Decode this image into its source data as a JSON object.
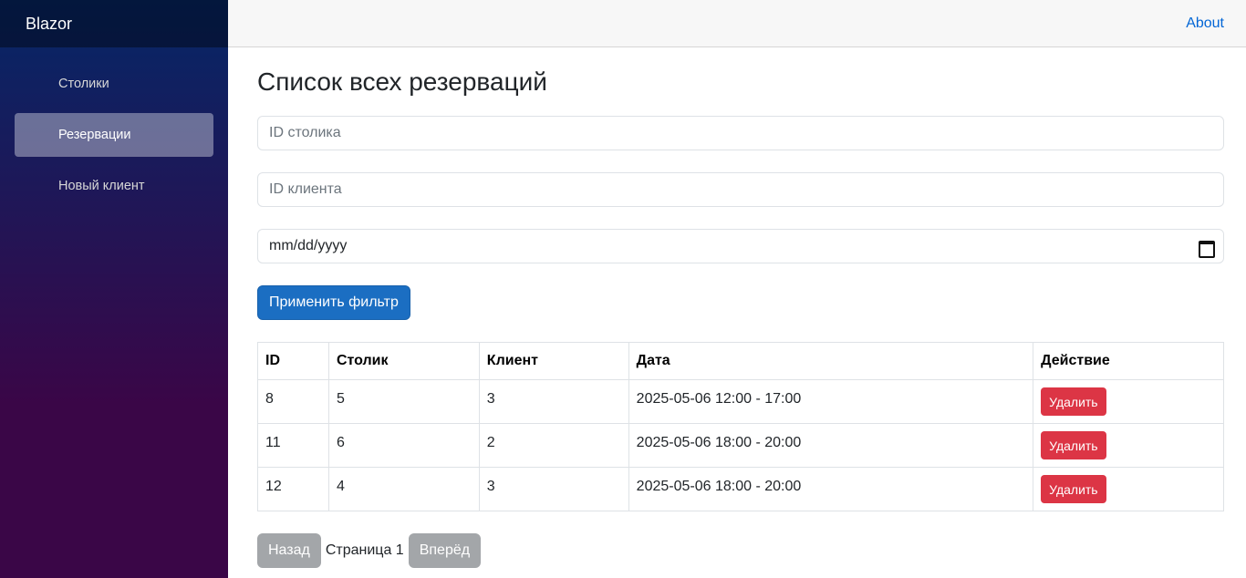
{
  "app": {
    "brand": "Blazor"
  },
  "sidebar": {
    "items": [
      {
        "label": "Столики",
        "active": false
      },
      {
        "label": "Резервации",
        "active": true
      },
      {
        "label": "Новый клиент",
        "active": false
      }
    ]
  },
  "topbar": {
    "about_label": "About"
  },
  "page": {
    "title": "Список всех резерваций"
  },
  "filters": {
    "table_id_placeholder": "ID столика",
    "client_id_placeholder": "ID клиента",
    "date_value": "mm/dd/yyyy",
    "apply_label": "Применить фильтр"
  },
  "table": {
    "headers": [
      "ID",
      "Столик",
      "Клиент",
      "Дата",
      "Действие"
    ],
    "rows": [
      {
        "id": "8",
        "table": "5",
        "client": "3",
        "date": "2025-05-06 12:00 - 17:00",
        "action": "Удалить"
      },
      {
        "id": "11",
        "table": "6",
        "client": "2",
        "date": "2025-05-06 18:00 - 20:00",
        "action": "Удалить"
      },
      {
        "id": "12",
        "table": "4",
        "client": "3",
        "date": "2025-05-06 18:00 - 20:00",
        "action": "Удалить"
      }
    ]
  },
  "pager": {
    "prev_label": "Назад",
    "page_text": "Страница 1",
    "next_label": "Вперёд"
  },
  "colors": {
    "primary": "#1b6ec2",
    "danger": "#dc3545",
    "secondary_disabled": "#a3a6a9",
    "link": "#0366d6"
  }
}
